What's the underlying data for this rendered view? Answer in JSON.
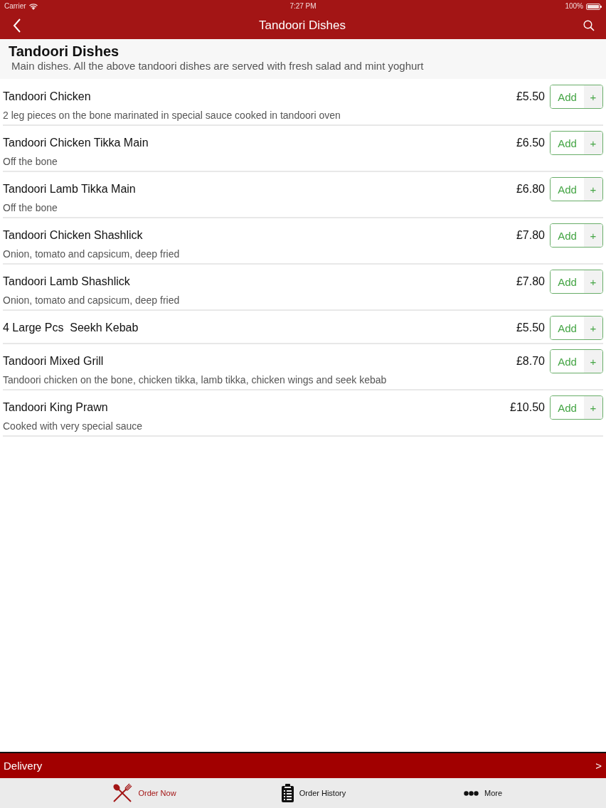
{
  "status_bar": {
    "carrier": "Carrier",
    "time": "7:27 PM",
    "battery": "100%"
  },
  "nav_bar": {
    "title": "Tandoori Dishes"
  },
  "category": {
    "title": "Tandoori Dishes",
    "description": "Main dishes. All the above tandoori dishes are served with fresh salad and mint yoghurt"
  },
  "items": [
    {
      "name": "Tandoori Chicken",
      "price": "£5.50",
      "description": "2 leg pieces on the bone marinated in special sauce cooked in tandoori oven",
      "add_label": "Add",
      "plus_label": "+"
    },
    {
      "name": "Tandoori Chicken Tikka Main",
      "price": "£6.50",
      "description": "Off the bone",
      "add_label": "Add",
      "plus_label": "+"
    },
    {
      "name": "Tandoori Lamb Tikka Main",
      "price": "£6.80",
      "description": "Off the bone",
      "add_label": "Add",
      "plus_label": "+"
    },
    {
      "name": "Tandoori Chicken Shashlick",
      "price": "£7.80",
      "description": "Onion, tomato and capsicum, deep fried",
      "add_label": "Add",
      "plus_label": "+"
    },
    {
      "name": "Tandoori Lamb Shashlick",
      "price": "£7.80",
      "description": "Onion, tomato and capsicum, deep fried",
      "add_label": "Add",
      "plus_label": "+"
    },
    {
      "name": "4 Large Pcs  Seekh Kebab",
      "price": "£5.50",
      "add_label": "Add",
      "plus_label": "+"
    },
    {
      "name": "Tandoori Mixed Grill",
      "price": "£8.70",
      "description": "Tandoori chicken on the bone, chicken tikka, lamb tikka, chicken wings and seek kebab",
      "add_label": "Add",
      "plus_label": "+"
    },
    {
      "name": "Tandoori King Prawn",
      "price": "£10.50",
      "description": "Cooked with very special sauce",
      "add_label": "Add",
      "plus_label": "+"
    }
  ],
  "delivery_bar": {
    "label": "Delivery",
    "arrow": ">"
  },
  "tabs": [
    {
      "label": "Order Now",
      "selected": true
    },
    {
      "label": "Order History",
      "selected": false
    },
    {
      "label": "More",
      "selected": false
    }
  ]
}
